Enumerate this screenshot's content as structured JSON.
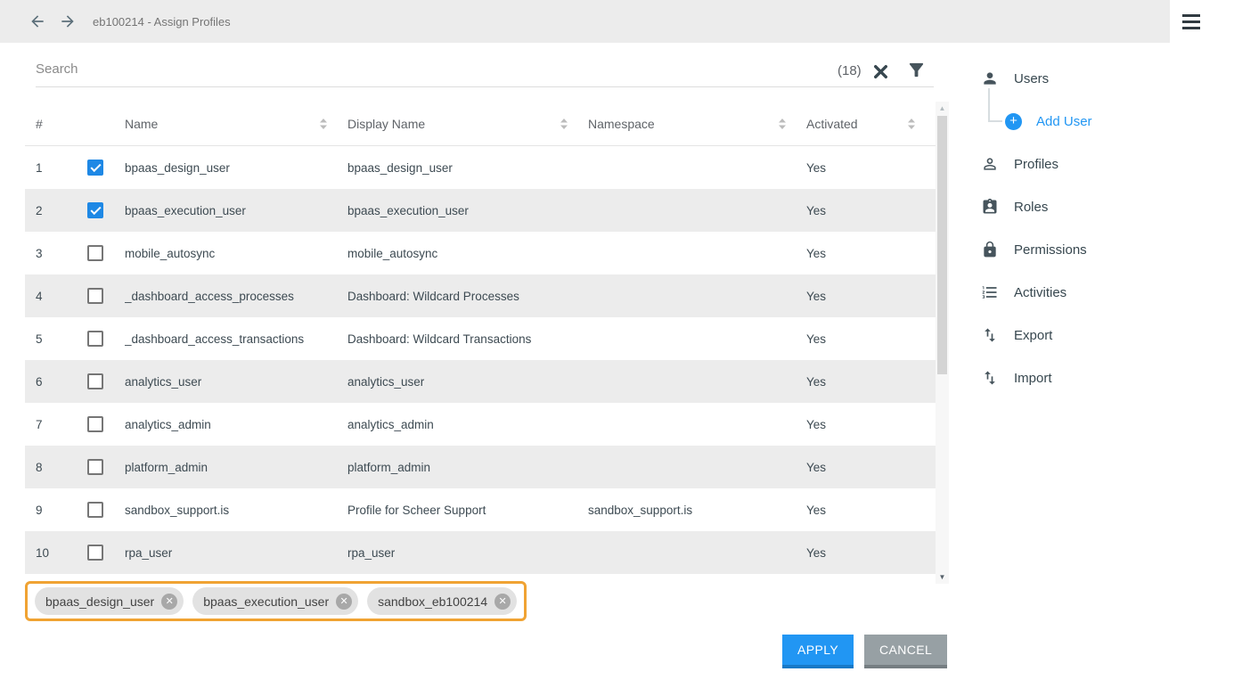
{
  "topbar": {
    "title": "eb100214 - Assign Profiles"
  },
  "search": {
    "placeholder": "Search",
    "count": "(18)"
  },
  "table": {
    "columns": {
      "num": "#",
      "name": "Name",
      "display": "Display Name",
      "namespace": "Namespace",
      "activated": "Activated"
    },
    "rows": [
      {
        "num": "1",
        "checked": true,
        "name": "bpaas_design_user",
        "display_name": "bpaas_design_user",
        "namespace": "",
        "activated": "Yes"
      },
      {
        "num": "2",
        "checked": true,
        "name": "bpaas_execution_user",
        "display_name": "bpaas_execution_user",
        "namespace": "",
        "activated": "Yes"
      },
      {
        "num": "3",
        "checked": false,
        "name": "mobile_autosync",
        "display_name": "mobile_autosync",
        "namespace": "",
        "activated": "Yes"
      },
      {
        "num": "4",
        "checked": false,
        "name": "_dashboard_access_processes",
        "display_name": "Dashboard: Wildcard Processes",
        "namespace": "",
        "activated": "Yes"
      },
      {
        "num": "5",
        "checked": false,
        "name": "_dashboard_access_transactions",
        "display_name": "Dashboard: Wildcard Transactions",
        "namespace": "",
        "activated": "Yes"
      },
      {
        "num": "6",
        "checked": false,
        "name": "analytics_user",
        "display_name": "analytics_user",
        "namespace": "",
        "activated": "Yes"
      },
      {
        "num": "7",
        "checked": false,
        "name": "analytics_admin",
        "display_name": "analytics_admin",
        "namespace": "",
        "activated": "Yes"
      },
      {
        "num": "8",
        "checked": false,
        "name": "platform_admin",
        "display_name": "platform_admin",
        "namespace": "",
        "activated": "Yes"
      },
      {
        "num": "9",
        "checked": false,
        "name": "sandbox_support.is",
        "display_name": "Profile for Scheer Support",
        "namespace": "sandbox_support.is",
        "activated": "Yes"
      },
      {
        "num": "10",
        "checked": false,
        "name": "rpa_user",
        "display_name": "rpa_user",
        "namespace": "",
        "activated": "Yes"
      }
    ]
  },
  "chips": [
    {
      "label": "bpaas_design_user"
    },
    {
      "label": "bpaas_execution_user"
    },
    {
      "label": "sandbox_eb100214"
    }
  ],
  "actions": {
    "apply": "APPLY",
    "cancel": "CANCEL"
  },
  "sidebar": {
    "items": [
      {
        "label": "Users"
      },
      {
        "label": "Add User"
      },
      {
        "label": "Profiles"
      },
      {
        "label": "Roles"
      },
      {
        "label": "Permissions"
      },
      {
        "label": "Activities"
      },
      {
        "label": "Export"
      },
      {
        "label": "Import"
      }
    ]
  },
  "icons": {
    "back": "arrow-back",
    "forward": "arrow-forward",
    "menu": "hamburger",
    "clear": "close-x",
    "filter": "funnel",
    "sort": "up-down-carets",
    "users": "person",
    "add_user": "plus-circle",
    "profiles": "person-outline",
    "roles": "id-badge",
    "permissions": "lock",
    "activities": "numbered-list",
    "export": "up-down-arrows",
    "import": "up-down-arrows",
    "chip_remove": "circle-x"
  },
  "colors": {
    "accent": "#2196f3",
    "highlight": "#f0a333",
    "apply": "#2196f3",
    "cancel": "#97a0a4",
    "checkbox_checked": "#1e88e5"
  }
}
